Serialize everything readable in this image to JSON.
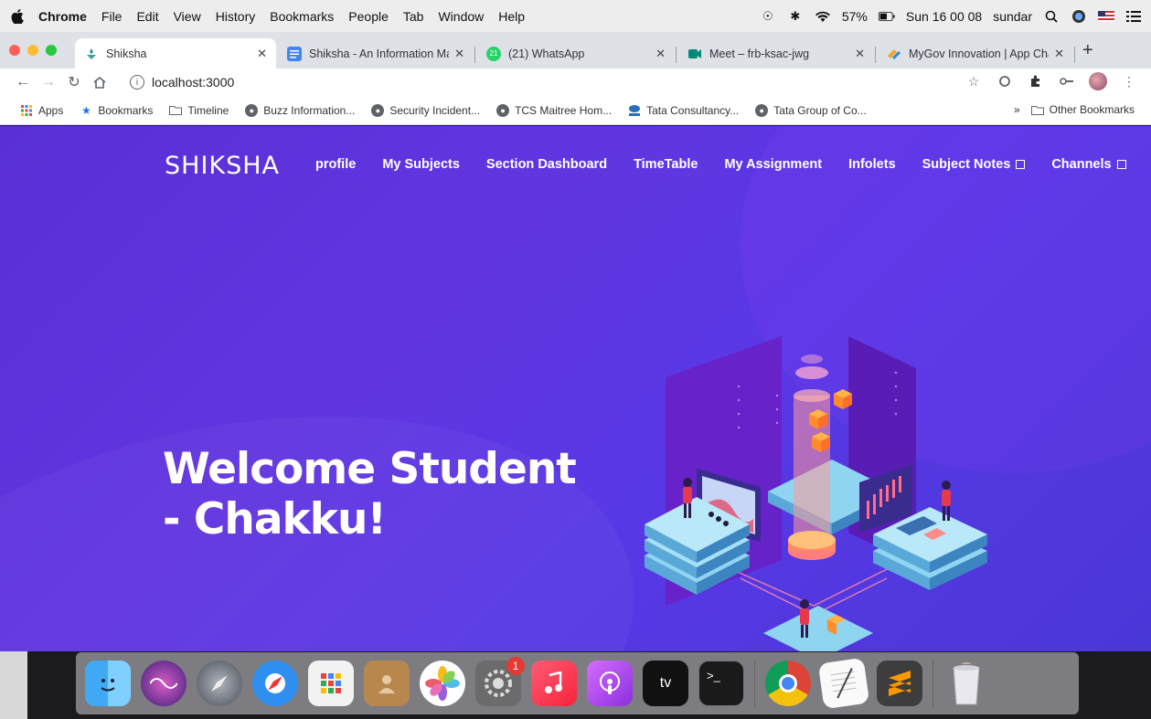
{
  "menubar": {
    "app": "Chrome",
    "items": [
      "File",
      "Edit",
      "View",
      "History",
      "Bookmarks",
      "People",
      "Tab",
      "Window",
      "Help"
    ],
    "battery": "57%",
    "clock": "Sun 16 00 08",
    "user": "sundar"
  },
  "tabs": [
    {
      "label": "Shiksha",
      "active": true
    },
    {
      "label": "Shiksha - An Information Ma",
      "active": false
    },
    {
      "label": "(21) WhatsApp",
      "active": false,
      "badge": "21"
    },
    {
      "label": "Meet – frb-ksac-jwg",
      "active": false
    },
    {
      "label": "MyGov Innovation | App Cha",
      "active": false
    }
  ],
  "address": {
    "url": "localhost:3000"
  },
  "bookmarks": {
    "items": [
      "Apps",
      "Bookmarks",
      "Timeline",
      "Buzz Information...",
      "Security Incident...",
      "TCS Maitree Hom...",
      "Tata Consultancy...",
      "Tata Group of Co..."
    ],
    "overflow": "»",
    "other": "Other Bookmarks"
  },
  "site": {
    "brand": "SHIKSHA",
    "nav": [
      "profile",
      "My Subjects",
      "Section Dashboard",
      "TimeTable",
      "My Assignment",
      "Infolets",
      "Subject Notes",
      "Channels"
    ],
    "headline_line1": "Welcome Student",
    "headline_line2": "- Chakku!"
  },
  "dock": {
    "apps": [
      "finder-icon",
      "siri-icon",
      "launchpad-icon",
      "safari-icon",
      "app-grid-icon",
      "contacts-icon",
      "photos-icon",
      "system-preferences-icon",
      "music-icon",
      "podcasts-icon",
      "apple-tv-icon",
      "terminal-icon",
      "chrome-icon",
      "textedit-icon",
      "sublime-text-icon",
      "trash-icon"
    ],
    "prefs_badge": "1",
    "tv_label": "tv",
    "terminal_prompt": ">_"
  },
  "colors": {
    "page_bg": "#5a35de",
    "accent": "#ffffff"
  }
}
